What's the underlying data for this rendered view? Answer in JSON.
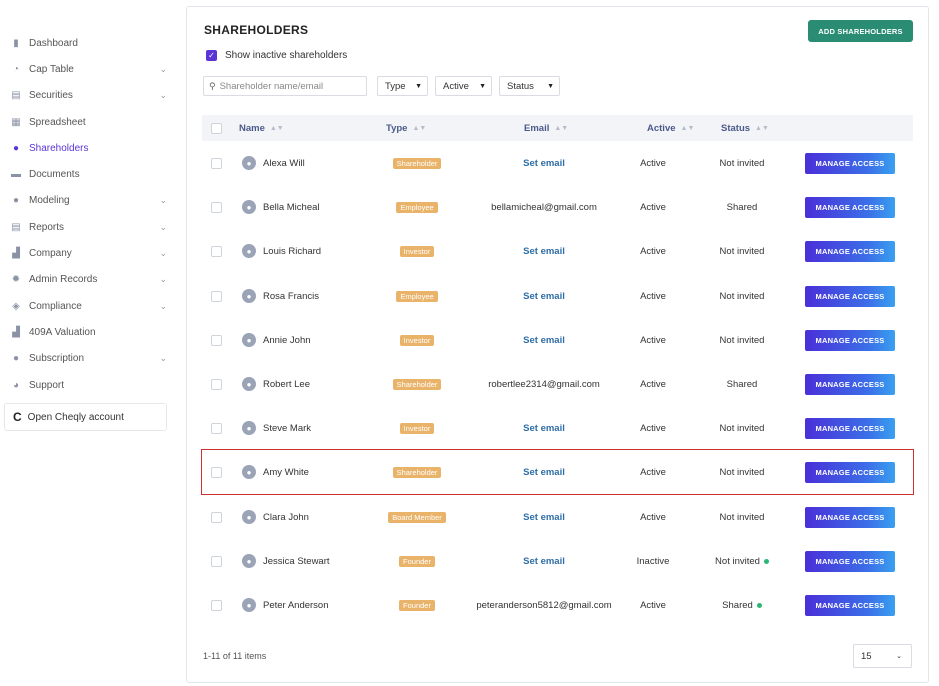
{
  "sidebar": {
    "items": [
      {
        "label": "Dashboard",
        "icon": "dashboard-icon",
        "glyph": "▮",
        "chevron": false
      },
      {
        "label": "Cap Table",
        "icon": "pie-chart-icon",
        "glyph": "◔",
        "chevron": true
      },
      {
        "label": "Securities",
        "icon": "document-icon",
        "glyph": "▤",
        "chevron": true
      },
      {
        "label": "Spreadsheet",
        "icon": "spreadsheet-icon",
        "glyph": "▦",
        "chevron": false
      },
      {
        "label": "Shareholders",
        "icon": "person-icon",
        "glyph": "●",
        "chevron": false,
        "active": true
      },
      {
        "label": "Documents",
        "icon": "folder-icon",
        "glyph": "▬",
        "chevron": false
      },
      {
        "label": "Modeling",
        "icon": "bulb-icon",
        "glyph": "●",
        "chevron": true
      },
      {
        "label": "Reports",
        "icon": "report-icon",
        "glyph": "▤",
        "chevron": true
      },
      {
        "label": "Company",
        "icon": "building-icon",
        "glyph": "▟",
        "chevron": true
      },
      {
        "label": "Admin Records",
        "icon": "gear-icon",
        "glyph": "✹",
        "chevron": true
      },
      {
        "label": "Compliance",
        "icon": "shield-icon",
        "glyph": "◈",
        "chevron": true
      },
      {
        "label": "409A Valuation",
        "icon": "chart-icon",
        "glyph": "▟",
        "chevron": false
      },
      {
        "label": "Subscription",
        "icon": "dollar-icon",
        "glyph": "●",
        "chevron": true
      },
      {
        "label": "Support",
        "icon": "support-icon",
        "glyph": "◕",
        "chevron": false
      }
    ],
    "cheqly_label": "Open Cheqly account",
    "cheqly_glyph": "C"
  },
  "header": {
    "title": "SHAREHOLDERS",
    "add_button": "ADD SHAREHOLDERS",
    "show_inactive_label": "Show inactive shareholders",
    "show_inactive_checked": true
  },
  "filters": {
    "search_placeholder": "Shareholder name/email",
    "type": "Type",
    "active": "Active",
    "status": "Status"
  },
  "table": {
    "columns": {
      "name": "Name",
      "type": "Type",
      "email": "Email",
      "active": "Active",
      "status": "Status"
    },
    "action_label": "MANAGE ACCESS",
    "rows": [
      {
        "name": "Alexa Will",
        "type": "Shareholder",
        "email": "Set email",
        "active": "Active",
        "status": "Not invited",
        "dot": false
      },
      {
        "name": "Bella Micheal",
        "type": "Employee",
        "email": "bellamicheal@gmail.com",
        "active": "Active",
        "status": "Shared",
        "dot": false
      },
      {
        "name": "Louis Richard",
        "type": "Investor",
        "email": "Set email",
        "active": "Active",
        "status": "Not invited",
        "dot": false
      },
      {
        "name": "Rosa Francis",
        "type": "Employee",
        "email": "Set email",
        "active": "Active",
        "status": "Not invited",
        "dot": false
      },
      {
        "name": "Annie John",
        "type": "Investor",
        "email": "Set email",
        "active": "Active",
        "status": "Not invited",
        "dot": false
      },
      {
        "name": "Robert Lee",
        "type": "Shareholder",
        "email": "robertlee2314@gmail.com",
        "active": "Active",
        "status": "Shared",
        "dot": false
      },
      {
        "name": "Steve Mark",
        "type": "Investor",
        "email": "Set email",
        "active": "Active",
        "status": "Not invited",
        "dot": false
      },
      {
        "name": "Amy White",
        "type": "Shareholder",
        "email": "Set email",
        "active": "Active",
        "status": "Not invited",
        "dot": false,
        "highlighted": true
      },
      {
        "name": "Clara John",
        "type": "Board Member",
        "email": "Set email",
        "active": "Active",
        "status": "Not invited",
        "dot": false
      },
      {
        "name": "Jessica Stewart",
        "type": "Founder",
        "email": "Set email",
        "active": "Inactive",
        "status": "Not invited",
        "dot": true
      },
      {
        "name": "Peter Anderson",
        "type": "Founder",
        "email": "peteranderson5812@gmail.com",
        "active": "Active",
        "status": "Shared",
        "dot": true
      }
    ]
  },
  "footer": {
    "count": "1-11 of 11 items",
    "page_size": "15"
  },
  "colors": {
    "accent": "#5b34d6",
    "add_button": "#2a8c73",
    "badge": "#e9b36a",
    "link": "#2e6ea6",
    "highlight": "#d0302f",
    "status_dot": "#2bb673"
  }
}
